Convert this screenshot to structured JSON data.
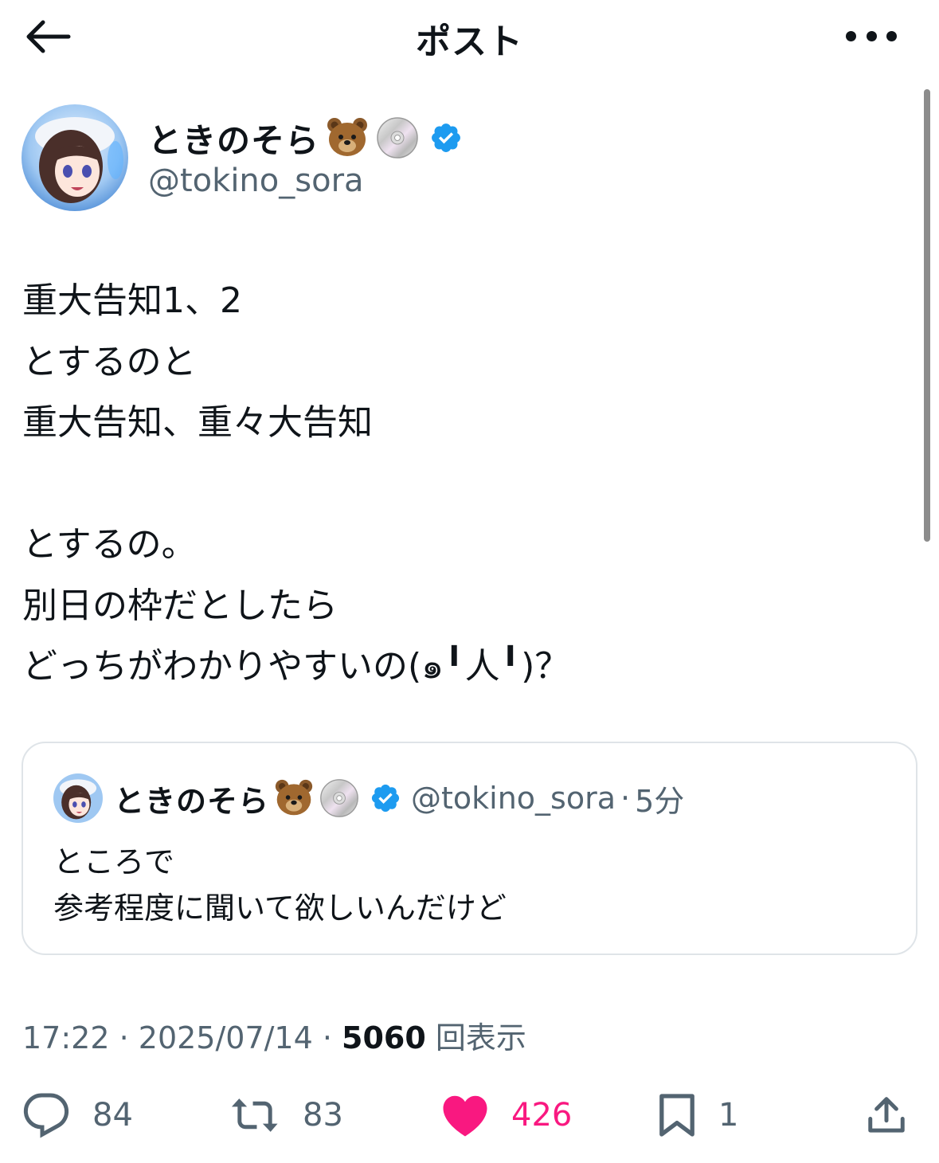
{
  "header": {
    "title": "ポスト"
  },
  "author": {
    "display_name": "ときのそら",
    "handle": "@tokino_sora",
    "emojis": [
      "bear-face-emoji",
      "optical-disc-emoji"
    ],
    "verified": true
  },
  "post": {
    "lines": [
      "重大告知1、2",
      "とするのと",
      "重大告知、重々大告知",
      "",
      "とするの。",
      "別日の枠だとしたら",
      "どっちがわかりやすいの(๑╹人╹)？"
    ]
  },
  "quote": {
    "display_name": "ときのそら",
    "handle": "@tokino_sora",
    "separator": "·",
    "time": "5分",
    "lines": [
      "ところで",
      "参考程度に聞いて欲しいんだけど"
    ]
  },
  "meta": {
    "time": "17:22",
    "sep1": " · ",
    "date": "2025/07/14",
    "sep2": " · ",
    "views_count": "5060",
    "views_label": " 回表示"
  },
  "actions": {
    "replies": "84",
    "reposts": "83",
    "likes": "426",
    "bookmarks": "1"
  },
  "colors": {
    "text": "#0f1419",
    "secondary": "#536471",
    "verified": "#1d9bf0",
    "like": "#f91880",
    "border": "#dfe4e8"
  }
}
